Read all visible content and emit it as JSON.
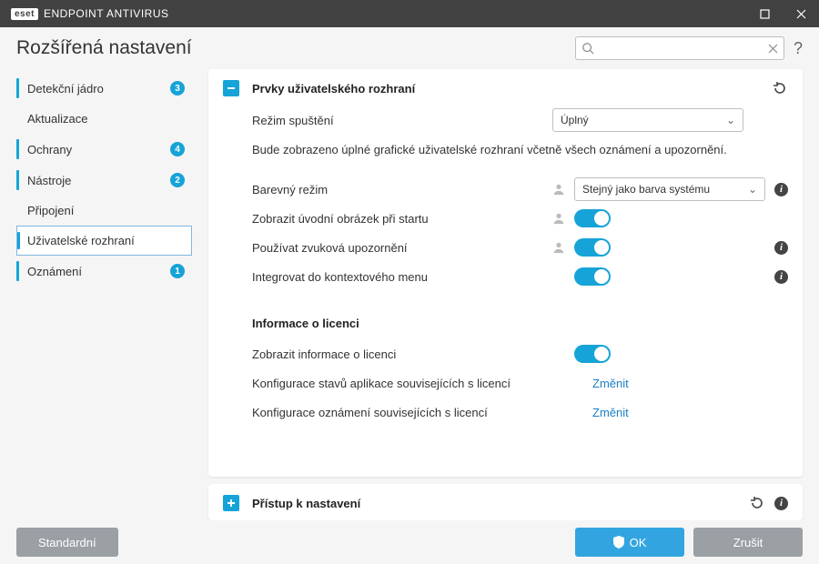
{
  "titlebar": {
    "brand": "eset",
    "title": "ENDPOINT ANTIVIRUS"
  },
  "page_title": "Rozšířená nastavení",
  "search": {
    "placeholder": ""
  },
  "sidebar": {
    "items": [
      {
        "label": "Detekční jádro",
        "badge": "3",
        "accented": true
      },
      {
        "label": "Aktualizace",
        "badge": null,
        "accented": false
      },
      {
        "label": "Ochrany",
        "badge": "4",
        "accented": true
      },
      {
        "label": "Nástroje",
        "badge": "2",
        "accented": true
      },
      {
        "label": "Připojení",
        "badge": null,
        "accented": false
      },
      {
        "label": "Uživatelské rozhraní",
        "badge": null,
        "selected": true,
        "accented": true
      },
      {
        "label": "Oznámení",
        "badge": "1",
        "accented": true
      }
    ]
  },
  "panel1": {
    "title": "Prvky uživatelského rozhraní",
    "startup_mode_label": "Režim spuštění",
    "startup_mode_value": "Úplný",
    "startup_mode_desc": "Bude zobrazeno úplné grafické uživatelské rozhraní včetně všech oznámení a upozornění.",
    "color_mode_label": "Barevný režim",
    "color_mode_value": "Stejný jako barva systému",
    "splash_label": "Zobrazit úvodní obrázek při startu",
    "sound_label": "Používat zvuková upozornění",
    "context_label": "Integrovat do kontextového menu",
    "license_heading": "Informace o licenci",
    "show_license_label": "Zobrazit informace o licenci",
    "app_states_label": "Konfigurace stavů aplikace souvisejících s licencí",
    "notif_config_label": "Konfigurace oznámení souvisejících s licencí",
    "change_link": "Změnit"
  },
  "panel2": {
    "title": "Přístup k nastavení"
  },
  "footer": {
    "default": "Standardní",
    "ok": "OK",
    "cancel": "Zrušit"
  }
}
